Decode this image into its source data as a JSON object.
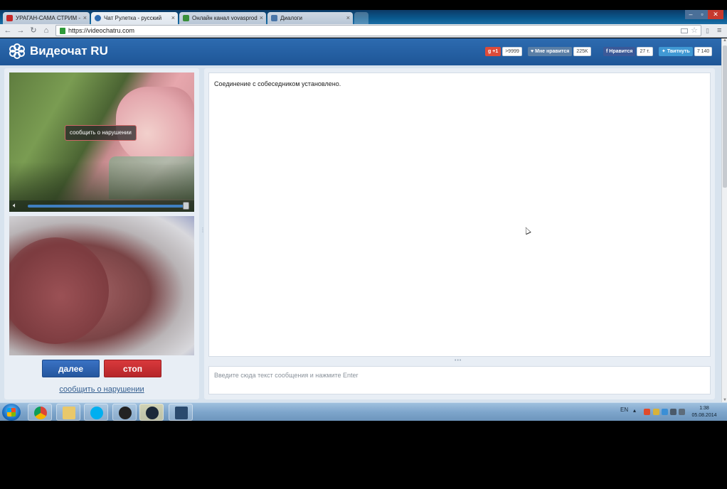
{
  "browser": {
    "tabs": [
      {
        "label": "УРАГАН-САМА СТРИМ -",
        "icon_color": "#c62828"
      },
      {
        "label": "Чат Рулетка - русский",
        "icon_color": "#2d6bb0",
        "active": true
      },
      {
        "label": "Онлайн канал vovasprod",
        "icon_color": "#3a8f3a"
      },
      {
        "label": "Диалоги",
        "icon_color": "#4a76a8"
      }
    ],
    "url": "https://videochatru.com",
    "back_icon": "back-arrow-icon",
    "forward_icon": "forward-arrow-icon",
    "reload_icon": "reload-icon",
    "home_icon": "home-icon"
  },
  "site": {
    "logo_text": "Видеочат RU",
    "social": {
      "gplus_label": "+1",
      "gplus_count": ">9999",
      "vk_label": "Мне нравится",
      "vk_count": "225K",
      "fb_label": "Нравится",
      "fb_count": "27 т.",
      "tw_label": "Твитнуть",
      "tw_count": "7 140"
    },
    "colors": {
      "header": "#2d6bb0",
      "next_button": "#2f65b5",
      "stop_button": "#c8302f",
      "gplus": "#dd4b39",
      "vk": "#5b7fa6",
      "fb": "#3b5998",
      "tw": "#4099d4"
    }
  },
  "video": {
    "report_tooltip": "сообщить о нарушении",
    "volume_level": 1.0
  },
  "controls": {
    "next_label": "далее",
    "stop_label": "стоп",
    "report_link": "сообщить о нарушении"
  },
  "chat": {
    "messages": [
      "Соединение с собеседником установлено."
    ],
    "input_placeholder": "Введите сюда текст сообщения и нажмите Enter"
  },
  "taskbar": {
    "language": "EN",
    "time": "1:38",
    "date": "05.08.2014"
  }
}
